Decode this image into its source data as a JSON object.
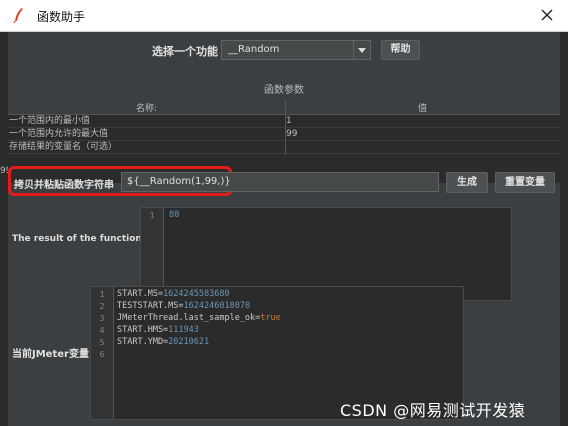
{
  "window": {
    "title": "函数助手"
  },
  "edge_digit": "99",
  "function_select": {
    "label": "选择一个功能",
    "value": "__Random",
    "help_label": "帮助"
  },
  "params": {
    "title": "函数参数",
    "headers": [
      "名称:",
      "值"
    ],
    "rows": [
      {
        "name": "一个范围内的最小值",
        "value": "1"
      },
      {
        "name": "一个范围内允许的最大值",
        "value": "99"
      },
      {
        "name": "存储结果的变量名（可选）",
        "value": ""
      }
    ]
  },
  "copy": {
    "label": "拷贝并粘贴函数字符串",
    "value": "${__Random(1,99,)}",
    "generate_label": "生成",
    "reset_label": "重置变量"
  },
  "result": {
    "label": "The result of the function is",
    "lines": [
      {
        "num": "1",
        "text": "80"
      }
    ]
  },
  "variables": {
    "label": "当前JMeter变量",
    "lines": [
      {
        "num": "1",
        "key": "START.MS=",
        "val": "1624245583680",
        "type": "n"
      },
      {
        "num": "2",
        "key": "TESTSTART.MS=",
        "val": "1624246018070",
        "type": "n"
      },
      {
        "num": "3",
        "key": "JMeterThread.last_sample_ok=",
        "val": "true",
        "type": "b"
      },
      {
        "num": "4",
        "key": "START.HMS=",
        "val": "111943",
        "type": "n"
      },
      {
        "num": "5",
        "key": "START.YMD=",
        "val": "20210621",
        "type": "n"
      },
      {
        "num": "6",
        "key": "",
        "val": "",
        "type": "n"
      }
    ]
  },
  "watermark": "CSDN @网易测试开发猿",
  "icons": {
    "app": "feather-icon",
    "close": "close-icon",
    "dropdown": "chevron-down-icon"
  },
  "colors": {
    "highlight": "#e41b1b",
    "number": "#6897bb",
    "boolean": "#cc7832"
  }
}
